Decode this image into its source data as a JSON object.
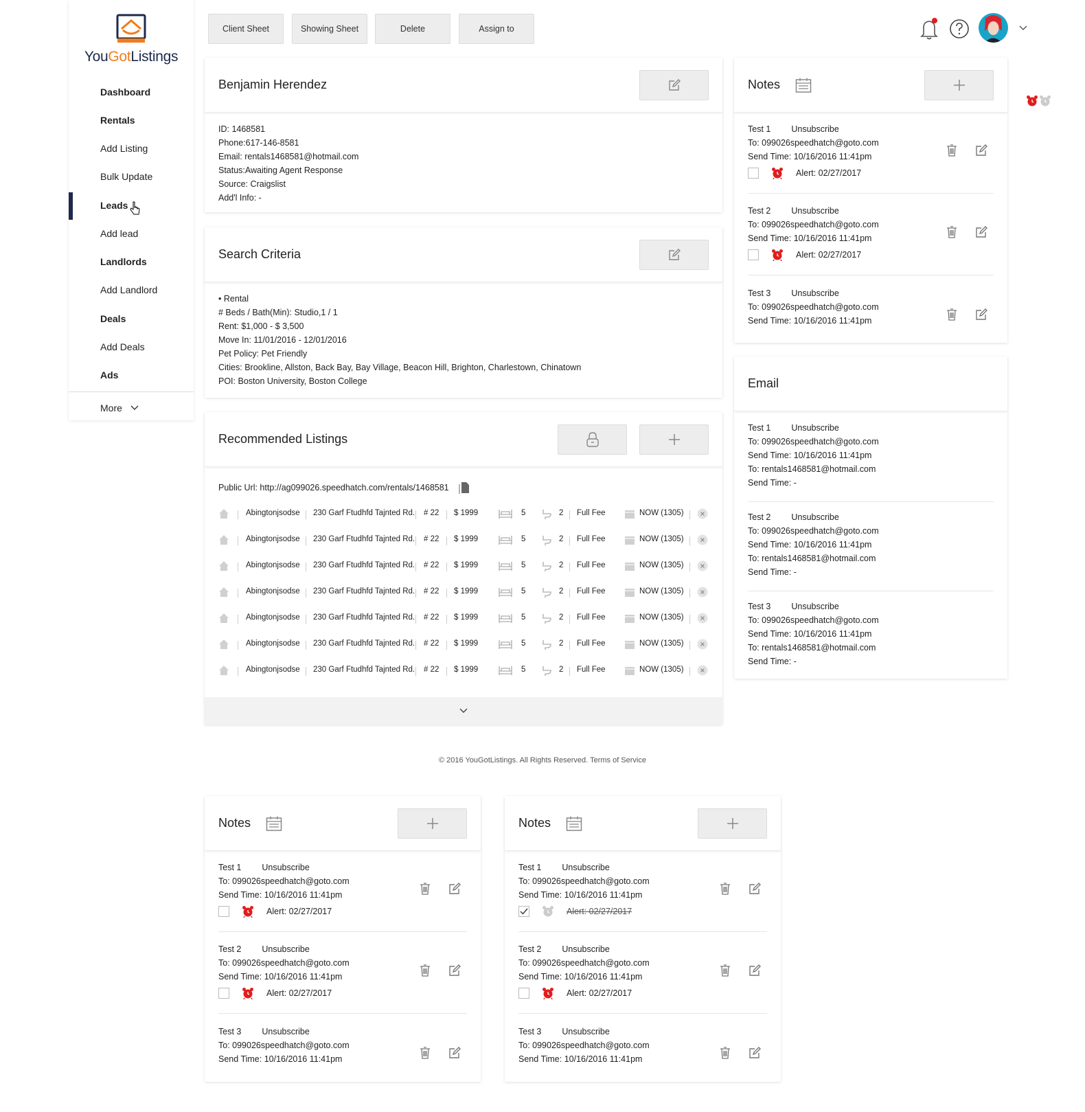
{
  "brand": {
    "part1": "You",
    "part2": "Got",
    "part3": "Listings"
  },
  "sidebar": {
    "items": [
      {
        "label": "Dashboard",
        "bold": true
      },
      {
        "label": "Rentals",
        "bold": true
      },
      {
        "label": "Add Listing",
        "bold": false
      },
      {
        "label": "Bulk Update",
        "bold": false
      },
      {
        "label": "Leads",
        "bold": true
      },
      {
        "label": "Add lead",
        "bold": false
      },
      {
        "label": "Landlords",
        "bold": true
      },
      {
        "label": "Add Landlord",
        "bold": false
      },
      {
        "label": "Deals",
        "bold": true
      },
      {
        "label": "Add Deals",
        "bold": false
      },
      {
        "label": "Ads",
        "bold": true
      }
    ],
    "more_label": "More"
  },
  "toolbar": {
    "client_sheet": "Client Sheet",
    "showing_sheet": "Showing Sheet",
    "delete": "Delete",
    "assign_to": "Assign to"
  },
  "lead": {
    "name": "Benjamin Herendez",
    "id": "ID: 1468581",
    "phone": "Phone:617-146-8581",
    "email": "Email: rentals1468581@hotmail.com",
    "status": "Status:Awaiting Agent Response",
    "source": "Source: Craigslist",
    "info": "Add'l Info: -"
  },
  "search": {
    "title": "Search Criteria",
    "lines": [
      "• Rental",
      "# Beds / Bath(Min): Studio,1 / 1",
      "Rent: $1,000 - $ 3,500",
      "Move In: 11/01/2016 - 12/01/2016",
      "Pet Policy: Pet Friendly",
      "Cities: Brookline, Allston, Back Bay, Bay Village, Beacon Hill, Brighton, Charlestown, Chinatown",
      "POI: Boston University, Boston College"
    ]
  },
  "recommended": {
    "title": "Recommended Listings",
    "public_url": "Public Url: http://ag099026.speedhatch.com/rentals/1468581",
    "rows": [
      {
        "town": "Abingtonjsodse",
        "address": "230 Garf Ftudhfd Tajnted Rd.",
        "unit": "# 22",
        "price": "$ 1999",
        "beds": "5",
        "baths": "2",
        "fee": "Full Fee",
        "avail": "NOW (1305)"
      },
      {
        "town": "Abingtonjsodse",
        "address": "230 Garf Ftudhfd Tajnted Rd.",
        "unit": "# 22",
        "price": "$ 1999",
        "beds": "5",
        "baths": "2",
        "fee": "Full Fee",
        "avail": "NOW (1305)"
      },
      {
        "town": "Abingtonjsodse",
        "address": "230 Garf Ftudhfd Tajnted Rd.",
        "unit": "# 22",
        "price": "$ 1999",
        "beds": "5",
        "baths": "2",
        "fee": "Full Fee",
        "avail": "NOW (1305)"
      },
      {
        "town": "Abingtonjsodse",
        "address": "230 Garf Ftudhfd Tajnted Rd.",
        "unit": "# 22",
        "price": "$ 1999",
        "beds": "5",
        "baths": "2",
        "fee": "Full Fee",
        "avail": "NOW (1305)"
      },
      {
        "town": "Abingtonjsodse",
        "address": "230 Garf Ftudhfd Tajnted Rd.",
        "unit": "# 22",
        "price": "$ 1999",
        "beds": "5",
        "baths": "2",
        "fee": "Full Fee",
        "avail": "NOW (1305)"
      },
      {
        "town": "Abingtonjsodse",
        "address": "230 Garf Ftudhfd Tajnted Rd.",
        "unit": "# 22",
        "price": "$ 1999",
        "beds": "5",
        "baths": "2",
        "fee": "Full Fee",
        "avail": "NOW (1305)"
      },
      {
        "town": "Abingtonjsodse",
        "address": "230 Garf Ftudhfd Tajnted Rd.",
        "unit": "# 22",
        "price": "$ 1999",
        "beds": "5",
        "baths": "2",
        "fee": "Full Fee",
        "avail": "NOW (1305)"
      }
    ]
  },
  "notes_title": "Notes",
  "email_title": "Email",
  "notes": [
    {
      "title": "Test 1",
      "unsub": "Unsubscribe",
      "to": "To: 099026speedhatch@goto.com",
      "send": "Send Time: 10/16/2016 11:41pm",
      "alert": "Alert: 02/27/2017"
    },
    {
      "title": "Test 2",
      "unsub": "Unsubscribe",
      "to": "To: 099026speedhatch@goto.com",
      "send": "Send Time: 10/16/2016 11:41pm",
      "alert": "Alert: 02/27/2017"
    },
    {
      "title": "Test 3",
      "unsub": "Unsubscribe",
      "to": "To: 099026speedhatch@goto.com",
      "send": "Send Time: 10/16/2016 11:41pm"
    }
  ],
  "emails": [
    {
      "title": "Test 1",
      "unsub": "Unsubscribe",
      "to": "To: 099026speedhatch@goto.com",
      "send": "Send Time: 10/16/2016 11:41pm",
      "to2": "To: rentals1468581@hotmail.com",
      "send2": "Send Time: -"
    },
    {
      "title": "Test 2",
      "unsub": "Unsubscribe",
      "to": "To: 099026speedhatch@goto.com",
      "send": "Send Time: 10/16/2016 11:41pm",
      "to2": "To: rentals1468581@hotmail.com",
      "send2": "Send Time: -"
    },
    {
      "title": "Test 3",
      "unsub": "Unsubscribe",
      "to": "To: 099026speedhatch@goto.com",
      "send": "Send Time: 10/16/2016 11:41pm",
      "to2": "To: rentals1468581@hotmail.com",
      "send2": "Send Time: -"
    }
  ],
  "footer": "© 2016 YouGotListings. All Rights Reserved. Terms of Service",
  "colors": {
    "brand_navy": "#1d2a4d",
    "brand_orange": "#f07c1b",
    "alert_red": "#e01e1e"
  }
}
